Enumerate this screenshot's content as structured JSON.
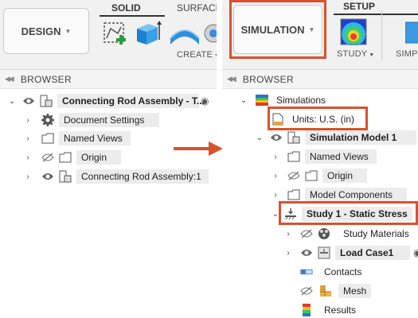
{
  "left": {
    "workspace_button": "DESIGN",
    "solid_group": "SOLID",
    "surface_group": "SURFACE",
    "create_dropdown": "CREATE",
    "browser_title": "BROWSER",
    "tree": [
      {
        "label": "Connecting Rod Assembly - T...",
        "icon": "assembly-icon"
      },
      {
        "label": "Document Settings",
        "icon": "gear-icon"
      },
      {
        "label": "Named Views",
        "icon": "folder-icon"
      },
      {
        "label": "Origin",
        "icon": "folder-icon"
      },
      {
        "label": "Connecting Rod Assembly:1",
        "icon": "component-icon"
      }
    ]
  },
  "right": {
    "workspace_button": "SIMULATION",
    "setup_group": "SETUP",
    "study_dropdown": "STUDY",
    "simp_label": "SIMP",
    "browser_title": "BROWSER",
    "tree": [
      {
        "label": "Simulations",
        "icon": "simulations-icon"
      },
      {
        "label": "Units: U.S. (in)",
        "icon": "units-icon"
      },
      {
        "label": "Simulation Model 1",
        "icon": "model-icon"
      },
      {
        "label": "Named Views",
        "icon": "folder-icon"
      },
      {
        "label": "Origin",
        "icon": "folder-icon"
      },
      {
        "label": "Model Components",
        "icon": "folder-icon"
      },
      {
        "label": "Study 1 - Static Stress",
        "icon": "static-stress-icon"
      },
      {
        "label": "Study Materials",
        "icon": "materials-icon"
      },
      {
        "label": "Load Case1",
        "icon": "load-case-icon"
      },
      {
        "label": "Contacts",
        "icon": "contacts-icon"
      },
      {
        "label": "Mesh",
        "icon": "mesh-icon"
      },
      {
        "label": "Results",
        "icon": "results-icon"
      }
    ]
  },
  "colors": {
    "highlight": "#d9512c",
    "arrow": "#d9512c",
    "toolbar_bg": "#f1f1f1",
    "folder_outline": "#555555"
  }
}
